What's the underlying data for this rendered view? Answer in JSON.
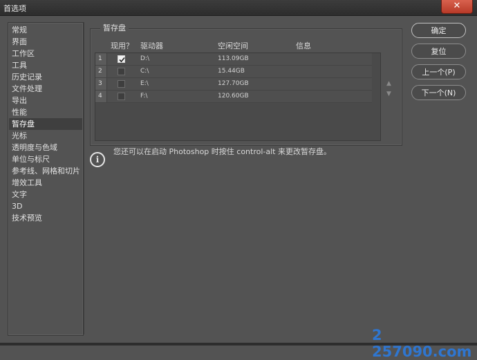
{
  "window": {
    "title": "首选项",
    "close_glyph": "✕"
  },
  "sidebar": {
    "items": [
      {
        "label": "常规",
        "selected": false
      },
      {
        "label": "界面",
        "selected": false
      },
      {
        "label": "工作区",
        "selected": false
      },
      {
        "label": "工具",
        "selected": false
      },
      {
        "label": "历史记录",
        "selected": false
      },
      {
        "label": "文件处理",
        "selected": false
      },
      {
        "label": "导出",
        "selected": false
      },
      {
        "label": "性能",
        "selected": false
      },
      {
        "label": "暂存盘",
        "selected": true
      },
      {
        "label": "光标",
        "selected": false
      },
      {
        "label": "透明度与色域",
        "selected": false
      },
      {
        "label": "单位与标尺",
        "selected": false
      },
      {
        "label": "参考线、网格和切片",
        "selected": false
      },
      {
        "label": "增效工具",
        "selected": false
      },
      {
        "label": "文字",
        "selected": false
      },
      {
        "label": "3D",
        "selected": false
      },
      {
        "label": "技术预览",
        "selected": false
      }
    ]
  },
  "scratch_disks": {
    "group_title": "暂存盘",
    "columns": {
      "active": "现用？",
      "drive": "驱动器",
      "free_space": "空闲空间",
      "info": "信息"
    },
    "rows": [
      {
        "index": "1",
        "checked": true,
        "drive": "D:\\",
        "free_space": "113.09GB",
        "info": ""
      },
      {
        "index": "2",
        "checked": false,
        "drive": "C:\\",
        "free_space": "15.44GB",
        "info": ""
      },
      {
        "index": "3",
        "checked": false,
        "drive": "E:\\",
        "free_space": "127.70GB",
        "info": ""
      },
      {
        "index": "4",
        "checked": false,
        "drive": "F:\\",
        "free_space": "120.60GB",
        "info": ""
      }
    ],
    "move_up_glyph": "▲",
    "move_down_glyph": "▼"
  },
  "buttons": {
    "ok": "确定",
    "reset": "复位",
    "prev": "上一个(P)",
    "next": "下一个(N)"
  },
  "info": {
    "icon_glyph": "i",
    "message": "您还可以在启动 Photoshop 时按住 control-alt 来更改暂存盘。"
  },
  "watermark": "2 257090.com"
}
